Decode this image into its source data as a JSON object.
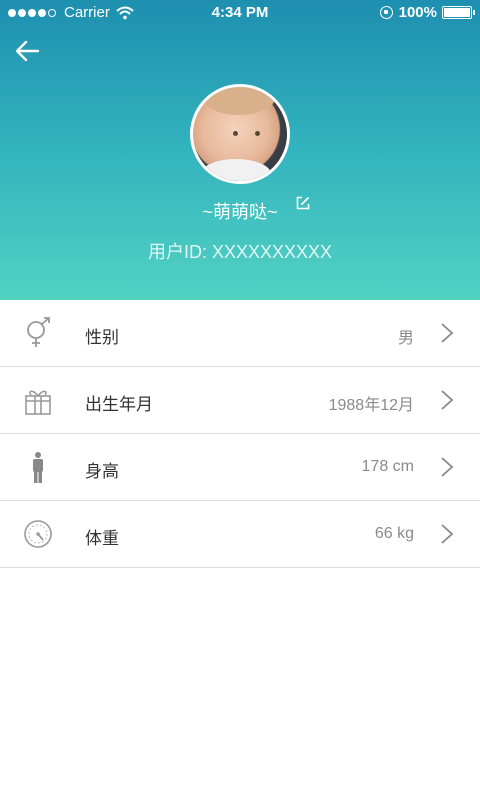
{
  "status_bar": {
    "carrier": "Carrier",
    "time": "4:34 PM",
    "battery": "100%"
  },
  "header": {
    "back_icon": "arrow-left-icon",
    "username": "~萌萌哒~",
    "edit_icon": "edit-icon",
    "user_id": "用户ID: XXXXXXXXXX"
  },
  "colors": {
    "header_top": "#1e8fb0",
    "header_bottom": "#52d2c2",
    "text_primary": "#333333",
    "text_secondary": "#8a8a8a",
    "divider": "#dddddd"
  },
  "profile_items": [
    {
      "icon": "gender-icon",
      "label": "性别",
      "value": "男"
    },
    {
      "icon": "gift-icon",
      "label": "出生年月",
      "value": "1988年12月"
    },
    {
      "icon": "person-icon",
      "label": "身高",
      "value": "178 cm"
    },
    {
      "icon": "scale-icon",
      "label": "体重",
      "value": "66 kg"
    }
  ]
}
